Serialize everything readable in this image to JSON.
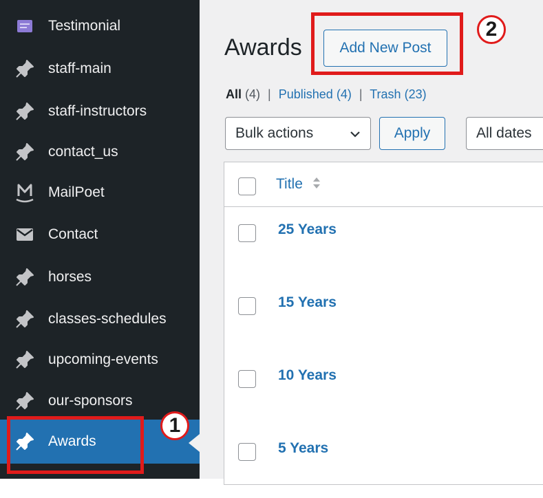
{
  "sidebar": {
    "items": [
      {
        "label": "Testimonial",
        "icon": "testimonial-icon"
      },
      {
        "label": "staff-main",
        "icon": "pin-icon"
      },
      {
        "label": "staff-instructors",
        "icon": "pin-icon"
      },
      {
        "label": "contact_us",
        "icon": "pin-icon"
      },
      {
        "label": "MailPoet",
        "icon": "mailpoet-icon"
      },
      {
        "label": "Contact",
        "icon": "envelope-icon"
      },
      {
        "label": "horses",
        "icon": "pin-icon"
      },
      {
        "label": "classes-schedules",
        "icon": "pin-icon"
      },
      {
        "label": "upcoming-events",
        "icon": "pin-icon"
      },
      {
        "label": "our-sponsors",
        "icon": "pin-icon"
      },
      {
        "label": "Awards",
        "icon": "pin-icon",
        "active": true
      }
    ]
  },
  "header": {
    "title": "Awards",
    "add_new_label": "Add New Post"
  },
  "filters": {
    "all_label": "All",
    "all_count": "(4)",
    "published_label": "Published",
    "published_count": "(4)",
    "trash_label": "Trash",
    "trash_count": "(23)",
    "separator": "|"
  },
  "toolbar": {
    "bulk_actions": "Bulk actions",
    "apply_label": "Apply",
    "dates_label": "All dates"
  },
  "table": {
    "columns": [
      "Title"
    ],
    "rows": [
      {
        "title": "25 Years"
      },
      {
        "title": "15 Years"
      },
      {
        "title": "10 Years"
      },
      {
        "title": "5 Years"
      }
    ]
  },
  "annotations": {
    "marker_1": "1",
    "marker_2": "2",
    "color": "#e01b1b"
  },
  "colors": {
    "sidebar_bg": "#1d2327",
    "accent": "#2271b1",
    "content_bg": "#f0f0f1"
  }
}
